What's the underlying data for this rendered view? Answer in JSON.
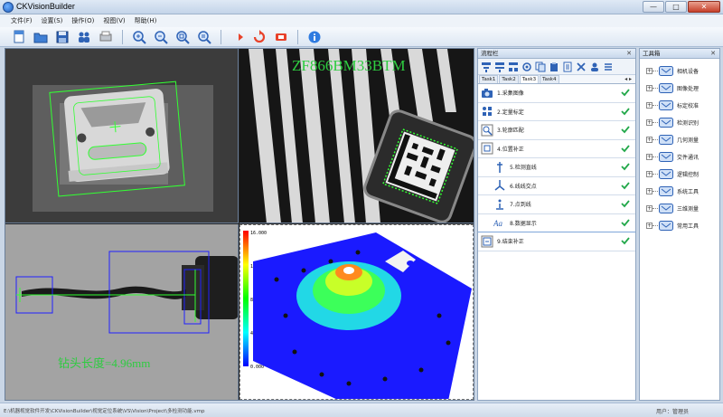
{
  "app": {
    "title": "CKVisionBuilder"
  },
  "window_buttons": {
    "minimize": "—",
    "maximize": "□",
    "close": "✕"
  },
  "menu": [
    "文件(F)",
    "设置(S)",
    "操作(O)",
    "视图(V)",
    "帮助(H)"
  ],
  "toolbar": {
    "groups": [
      [
        "new-icon",
        "open-folder-icon",
        "save-icon",
        "users-icon",
        "print-icon"
      ],
      [
        "zoom-in-icon",
        "zoom-out-icon",
        "zoom-fit-icon",
        "zoom-actual-icon"
      ],
      [
        "run-once-icon",
        "run-loop-icon",
        "stop-icon"
      ],
      [
        "info-icon"
      ]
    ]
  },
  "viewport": {
    "top_right_ocr": "ZF866BM33BTM",
    "bottom_left_measure": "钻头长度=4.96mm",
    "colorbar_ticks": [
      "16.000",
      "12.000",
      "8.000",
      "4.000",
      "0.000"
    ]
  },
  "flow_panel": {
    "title": "流程栏",
    "tabs": [
      "Task1",
      "Task2",
      "Task3",
      "Task4"
    ],
    "active_tab": 2,
    "steps": [
      {
        "label": "1.采集图像",
        "icon": "camera-icon",
        "sub": false
      },
      {
        "label": "2.定量标定",
        "icon": "calibrate-icon",
        "sub": false
      },
      {
        "label": "3.轮廓匹配",
        "icon": "match-icon",
        "sub": false
      },
      {
        "label": "4.位置补正",
        "icon": "position-icon",
        "sub": false
      },
      {
        "label": "5.检测直线",
        "icon": "line-icon",
        "sub": true
      },
      {
        "label": "6.线线交点",
        "icon": "intersection-icon",
        "sub": true
      },
      {
        "label": "7.点到线",
        "icon": "point-line-icon",
        "sub": true
      },
      {
        "label": "8.数据显示",
        "icon": "text-icon",
        "sub": true
      },
      {
        "label": "9.结束补正",
        "icon": "end-icon",
        "sub": false
      }
    ]
  },
  "toolbox": {
    "title": "工具箱",
    "items": [
      "相机设备",
      "图像处理",
      "标定校准",
      "检测识别",
      "几何测量",
      "交件通讯",
      "逻辑控制",
      "系统工具",
      "三维测量",
      "常用工具"
    ]
  },
  "statusbar": {
    "path": "E:\\机器视觉软件开发\\CKVisionBuilder\\视觉定位系统\\VS\\Vision\\Project\\多检测功能.vmp",
    "user": "用户：管理员"
  },
  "colors": {
    "check": "#22a84a",
    "accent": "#1f5fbf"
  }
}
